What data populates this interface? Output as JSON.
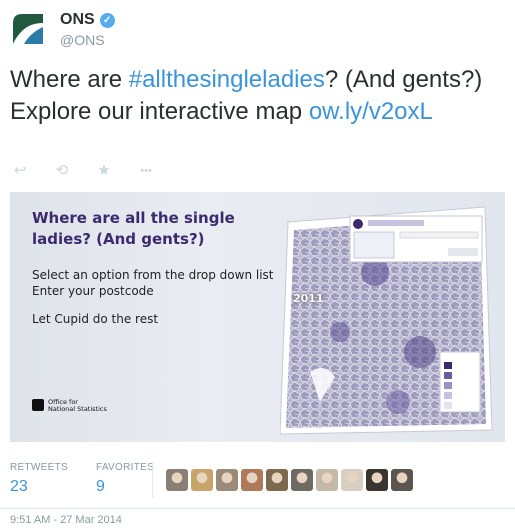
{
  "account": {
    "name": "ONS",
    "handle": "@ONS",
    "verified_glyph": "✓"
  },
  "tweet": {
    "text_before": "Where are ",
    "hashtag": "#allthesingleladies",
    "text_middle": "? (And gents?) Explore our interactive map ",
    "link": "ow.ly/v2oxL"
  },
  "actions": {
    "reply_icon": "↩",
    "retweet_icon": "⟲",
    "favorite_icon": "★",
    "more_icon": "•••"
  },
  "media": {
    "title": "Where are all the single ladies? (And gents?)",
    "line1": "Select an option from the drop down list",
    "line2": "Enter your postcode",
    "line3": "Let Cupid do the rest",
    "logo_line1": "Office for",
    "logo_line2": "National Statistics",
    "map_year": "2011"
  },
  "stats": {
    "retweets_label": "RETWEETS",
    "retweets_value": "23",
    "favorites_label": "FAVORITES",
    "favorites_value": "9"
  },
  "favoriters": [
    "#8a7f74",
    "#c9a46a",
    "#9b8a7a",
    "#b07a5a",
    "#7c6a4e",
    "#6e6a64",
    "#c4b9a8",
    "#d8cfc3",
    "#3a3530",
    "#5c5650"
  ],
  "timestamp": "9:51 AM - 27 Mar 2014",
  "colors": {
    "link": "#3b94d9",
    "media_title": "#3b2a6e",
    "avatar_bg": "#1f5a3e"
  }
}
